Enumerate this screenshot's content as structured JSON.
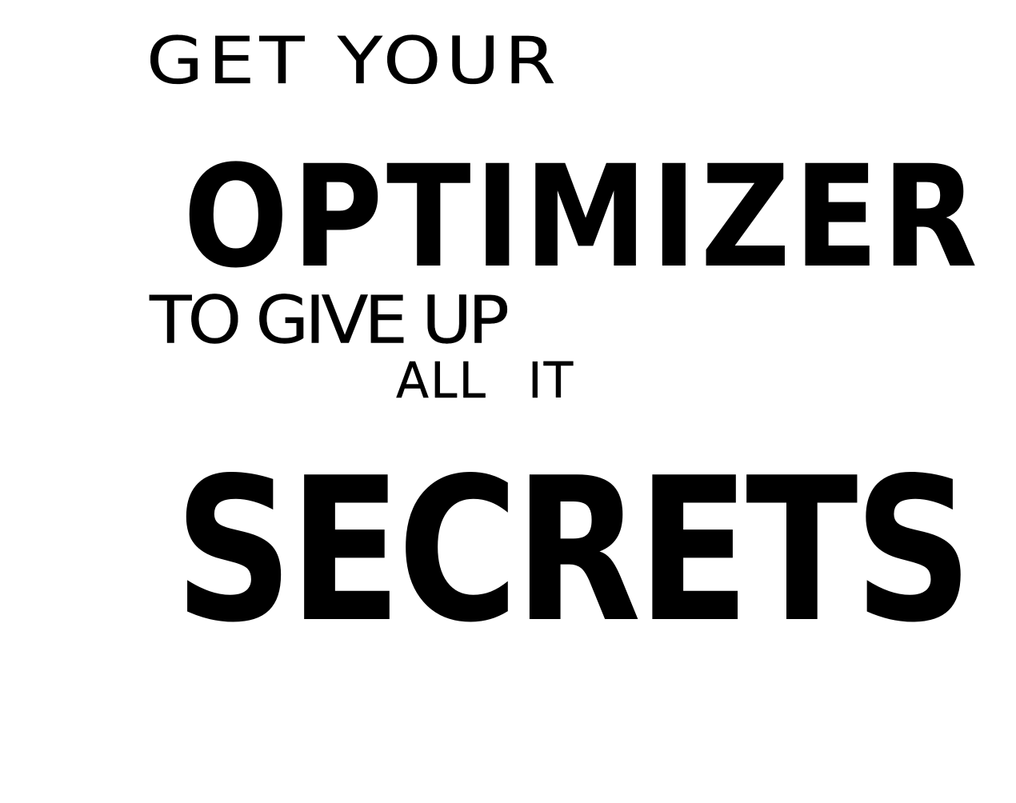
{
  "drawing": {
    "lines": [
      "GET YOUR",
      "OPTIMIZER",
      "TO GIVE UP",
      "ALL IT",
      "SECRETS"
    ],
    "ink_color": "#000000",
    "background_color": "#ffffff"
  }
}
